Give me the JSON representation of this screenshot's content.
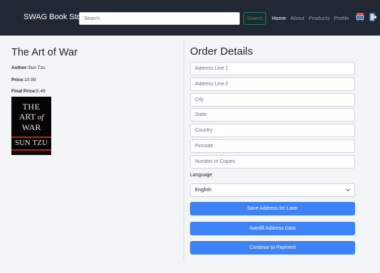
{
  "navbar": {
    "brand": "SWAG Book Store",
    "search_placeholder": "Search",
    "search_button": "Search",
    "links": [
      "Home",
      "About",
      "Products",
      "Profile"
    ],
    "active_link": "Home",
    "icons": [
      "cart-icon",
      "logout-icon"
    ]
  },
  "book": {
    "title": "The Art of War",
    "author_label": "Author:",
    "author": "Sun Tzu",
    "price_label": "Price:",
    "price": "10.99",
    "final_price_label": "Final Price:",
    "final_price": "5.49",
    "cover": {
      "line1": "THE",
      "line2_a": "ART",
      "line2_b": "of",
      "line3": "WAR",
      "line4": "SUN TZU"
    }
  },
  "order": {
    "title": "Order Details",
    "fields": [
      {
        "placeholder": "Address Line 1",
        "value": ""
      },
      {
        "placeholder": "Address Line 2",
        "value": ""
      },
      {
        "placeholder": "City",
        "value": ""
      },
      {
        "placeholder": "State",
        "value": ""
      },
      {
        "placeholder": "Country",
        "value": ""
      },
      {
        "placeholder": "Pincode",
        "value": ""
      },
      {
        "placeholder": "Number of Copies",
        "value": ""
      }
    ],
    "language_label": "Language",
    "language_selected": "English",
    "buttons": {
      "save": "Save Address for Later",
      "autofill": "Autofill Address Data",
      "continue": "Continue to Payment"
    }
  },
  "colors": {
    "navbar_bg": "#212833",
    "primary": "#3e82f7",
    "success": "#2ea44f",
    "cover_red": "#b3231f"
  }
}
